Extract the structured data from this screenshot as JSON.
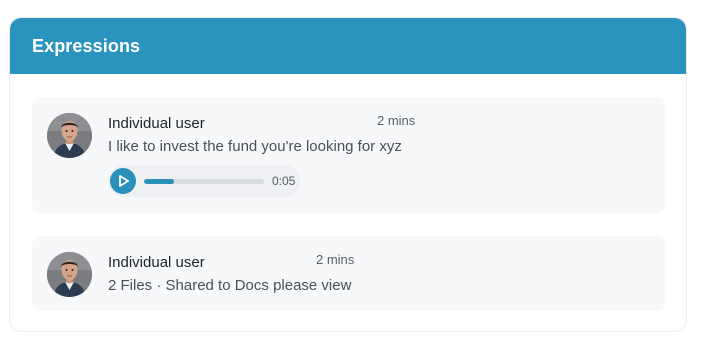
{
  "panel": {
    "title": "Expressions",
    "accent_color": "#2a93be"
  },
  "messages": [
    {
      "user": "Individual user",
      "time": "2 mins",
      "text": "I like to invest the fund you're looking for xyz",
      "avatar_icon": "user-avatar",
      "audio": {
        "icon": "play-icon",
        "duration": "0:05",
        "progress": 0.25
      }
    },
    {
      "user": "Individual user",
      "time": "2 mins",
      "text": "2 Files · Shared to Docs please view",
      "avatar_icon": "user-avatar"
    }
  ]
}
